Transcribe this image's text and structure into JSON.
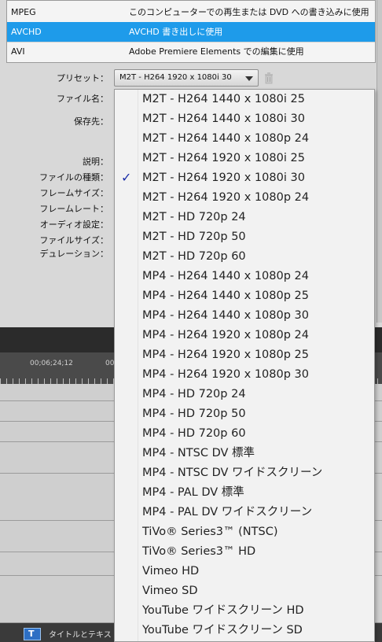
{
  "formats": [
    {
      "name": "MPEG",
      "desc": "このコンピューターでの再生または DVD への書き込みに使用",
      "selected": false
    },
    {
      "name": "AVCHD",
      "desc": "AVCHD 書き出しに使用",
      "selected": true
    },
    {
      "name": "AVI",
      "desc": "Adobe Premiere Elements での編集に使用",
      "selected": false
    }
  ],
  "form": {
    "preset_label": "プリセット：",
    "preset_value": "M2T - H264 1920 x 1080i 30",
    "filename_label": "ファイル名：",
    "dest_label": "保存先：",
    "description_label": "説明：",
    "filetype_label": "ファイルの種類：",
    "framesize_label": "フレームサイズ：",
    "framerate_label": "フレームレート：",
    "audio_label": "オーディオ設定：",
    "filesize_label": "ファイルサイズ：",
    "duration_label": "デュレーション："
  },
  "timeline": {
    "timecode_1": "00;06;24;12",
    "timecode_2": "00"
  },
  "bottom": {
    "title_icon_glyph": "T",
    "title_label": "タイトルとテキスト"
  },
  "dropdown": {
    "selected_index": 4,
    "options": [
      "M2T - H264 1440 x 1080i 25",
      "M2T - H264 1440 x 1080i 30",
      "M2T - H264 1440 x 1080p 24",
      "M2T - H264 1920 x 1080i 25",
      "M2T - H264 1920 x 1080i 30",
      "M2T - H264 1920 x 1080p 24",
      "M2T - HD 720p 24",
      "M2T - HD 720p 50",
      "M2T - HD 720p 60",
      "MP4 - H264 1440 x 1080p 24",
      "MP4 - H264 1440 x 1080p 25",
      "MP4 - H264 1440 x 1080p 30",
      "MP4 - H264 1920 x 1080p 24",
      "MP4 - H264 1920 x 1080p 25",
      "MP4 - H264 1920 x 1080p 30",
      "MP4 - HD 720p 24",
      "MP4 - HD 720p 50",
      "MP4 - HD 720p 60",
      "MP4 - NTSC DV 標準",
      "MP4 - NTSC DV ワイドスクリーン",
      "MP4 - PAL DV 標準",
      "MP4 - PAL DV ワイドスクリーン",
      "TiVo® Series3™ (NTSC)",
      "TiVo® Series3™ HD",
      "Vimeo HD",
      "Vimeo SD",
      "YouTube ワイドスクリーン HD",
      "YouTube ワイドスクリーン SD"
    ]
  },
  "colors": {
    "selection": "#1e9bea",
    "check": "#1b2ea8"
  }
}
